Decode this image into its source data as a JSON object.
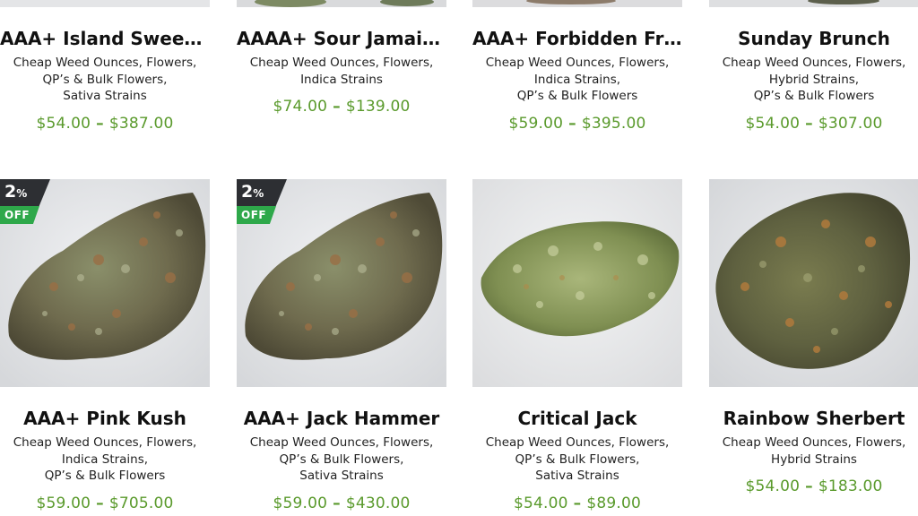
{
  "products_top": [
    {
      "title": "AAA+ Island Sweet S...",
      "cat_line1": "Cheap Weed Ounces, Flowers,",
      "cat_line2": "QP’s & Bulk Flowers,",
      "cat_line3": "Sativa Strains",
      "price_min": "$54.00",
      "price_max": "$387.00"
    },
    {
      "title": "AAAA+ Sour Jamaic...",
      "cat_line1": "Cheap Weed Ounces, Flowers,",
      "cat_line2": "Indica Strains",
      "cat_line3": "",
      "price_min": "$74.00",
      "price_max": "$139.00"
    },
    {
      "title": "AAA+ Forbidden Fruit",
      "cat_line1": "Cheap Weed Ounces, Flowers,",
      "cat_line2": "Indica Strains,",
      "cat_line3": "QP’s & Bulk Flowers",
      "price_min": "$59.00",
      "price_max": "$395.00"
    },
    {
      "title": "Sunday Brunch",
      "cat_line1": "Cheap Weed Ounces, Flowers,",
      "cat_line2": "Hybrid Strains,",
      "cat_line3": "QP’s & Bulk Flowers",
      "price_min": "$54.00",
      "price_max": "$307.00"
    }
  ],
  "products_bottom": [
    {
      "title": "AAA+ Pink Kush",
      "cat_line1": "Cheap Weed Ounces, Flowers,",
      "cat_line2": "Indica Strains,",
      "cat_line3": "QP’s & Bulk Flowers",
      "price_min": "$59.00",
      "price_max": "$705.00",
      "badge_pct": "2",
      "badge_pct_sign": "%",
      "badge_off": "OFF"
    },
    {
      "title": "AAA+ Jack Hammer",
      "cat_line1": "Cheap Weed Ounces, Flowers,",
      "cat_line2": "QP’s & Bulk Flowers,",
      "cat_line3": "Sativa Strains",
      "price_min": "$59.00",
      "price_max": "$430.00",
      "badge_pct": "2",
      "badge_pct_sign": "%",
      "badge_off": "OFF"
    },
    {
      "title": "Critical Jack",
      "cat_line1": "Cheap Weed Ounces, Flowers,",
      "cat_line2": "QP’s & Bulk Flowers,",
      "cat_line3": "Sativa Strains",
      "price_min": "$54.00",
      "price_max": "$89.00"
    },
    {
      "title": "Rainbow Sherbert",
      "cat_line1": "Cheap Weed Ounces, Flowers,",
      "cat_line2": "Hybrid Strains",
      "cat_line3": "",
      "price_min": "$54.00",
      "price_max": "$183.00"
    }
  ],
  "price_separator": "–",
  "colors": {
    "price": "#5a9a2c",
    "badge_dark": "#2d2f33",
    "badge_green": "#2ea84a"
  }
}
